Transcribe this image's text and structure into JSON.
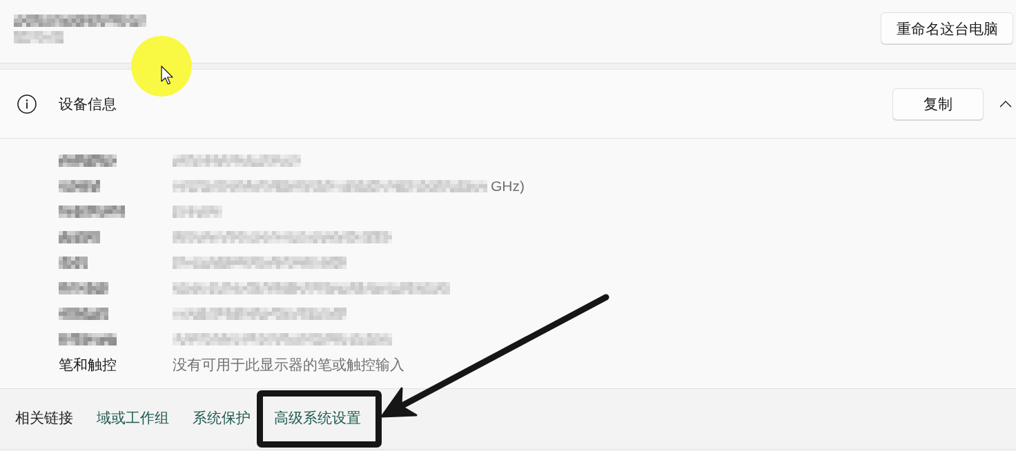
{
  "computer": {
    "name_redacted": true,
    "model_redacted": true,
    "rename_button": "重命名这台电脑"
  },
  "device_info": {
    "title": "设备信息",
    "copy_button": "复制",
    "expanded": true,
    "specs": [
      {
        "redacted": true
      },
      {
        "redacted": true,
        "value_tail": "GHz)"
      },
      {
        "redacted": true
      },
      {
        "redacted": true
      },
      {
        "redacted": true
      },
      {
        "redacted": true
      },
      {
        "redacted": true
      },
      {
        "redacted": true
      },
      {
        "redacted": false,
        "label": "笔和触控",
        "value": "没有可用于此显示器的笔或触控输入"
      }
    ]
  },
  "related_links": {
    "title": "相关链接",
    "links": [
      {
        "label": "域或工作组",
        "annotated": false
      },
      {
        "label": "系统保护",
        "annotated": false
      },
      {
        "label": "高级系统设置",
        "annotated": true
      }
    ]
  }
}
